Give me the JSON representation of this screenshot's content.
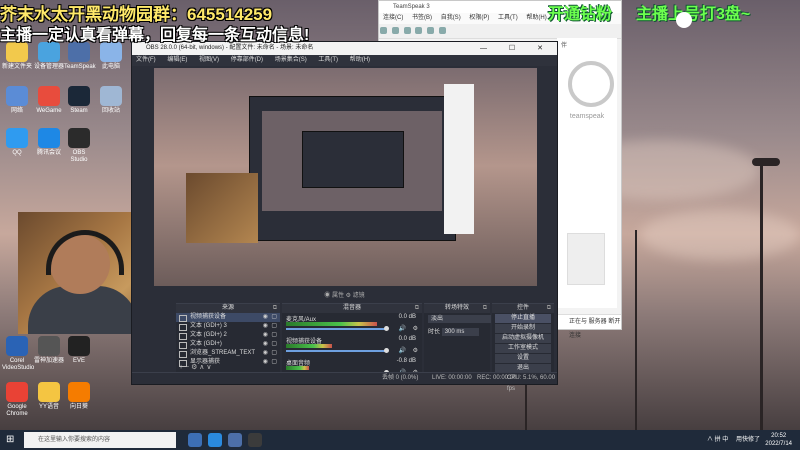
{
  "overlay": {
    "line1": "芥末水太开黑动物园群：645514259",
    "line2": "主播一定认真看弹幕，回复每一条互动信息!",
    "green1": "开通钻粉",
    "green2": "主播上号打3盘~"
  },
  "desktop_icons": [
    {
      "label": "新建文件夹",
      "color": "#f2c94c"
    },
    {
      "label": "设备管理器",
      "color": "#4aa3df"
    },
    {
      "label": "TeamSpeak",
      "color": "#4d6fa8"
    },
    {
      "label": "此电脑",
      "color": "#8ab4e8"
    },
    {
      "label": "网络",
      "color": "#5b8cd6"
    },
    {
      "label": "WeGame",
      "color": "#e84c3d"
    },
    {
      "label": "Steam",
      "color": "#1b2838"
    },
    {
      "label": "回收站",
      "color": "#9fb7d4"
    },
    {
      "label": "QQ",
      "color": "#2f9bf0"
    },
    {
      "label": "腾讯会议",
      "color": "#1e88e5"
    },
    {
      "label": "OBS Studio",
      "color": "#2b2b2b"
    },
    {
      "label": "Google Chrome",
      "color": "#e94235"
    },
    {
      "label": "YY语音",
      "color": "#f4c542"
    },
    {
      "label": "向日葵",
      "color": "#f57c00"
    },
    {
      "label": "Corel VideoStudio",
      "color": "#2a63b5"
    },
    {
      "label": "雷神加速器",
      "color": "#555"
    },
    {
      "label": "EVE",
      "color": "#222"
    }
  ],
  "obs": {
    "title": "OBS 28.0.0 (64-bit, windows) - 配置文件: 未命名 - 场景: 未命名",
    "window_buttons": "— ☐ ✕",
    "menu": [
      "文件(F)",
      "编辑(E)",
      "视图(V)",
      "停靠部件(D)",
      "场景集合(S)",
      "工具(T)",
      "帮助(H)"
    ],
    "preview_caption": "无标题",
    "preview_tools": "◉ 属性    ⚙ 滤镜",
    "dock_headers": {
      "scenes": "来源",
      "mixer": "混音器",
      "transitions": "转场特效",
      "controls": "控件"
    },
    "sources": [
      {
        "name": "视频捕获设备",
        "selected": true
      },
      {
        "name": "文本 (GDI+) 3",
        "selected": false
      },
      {
        "name": "文本 (GDI+) 2",
        "selected": false
      },
      {
        "name": "文本 (GDI+)",
        "selected": false
      },
      {
        "name": "浏览器_STREAM_TEXT",
        "selected": false
      },
      {
        "name": "显示器捕获",
        "selected": false
      }
    ],
    "mixer": [
      {
        "name": "麦克风/Aux",
        "db": "0.0 dB",
        "level": 0.8
      },
      {
        "name": "视频捕获设备",
        "db": "0.0 dB",
        "level": 0.4
      },
      {
        "name": "桌面音频",
        "db": "-0.8 dB",
        "level": 0.2
      }
    ],
    "transition": {
      "type": "淡出",
      "duration_label": "时长",
      "duration": "300 ms"
    },
    "controls": [
      {
        "label": "停止直播",
        "active": true
      },
      {
        "label": "开始录制",
        "active": false
      },
      {
        "label": "启动虚拟摄像机",
        "active": false
      },
      {
        "label": "工作室模式",
        "active": false
      },
      {
        "label": "设置",
        "active": false
      },
      {
        "label": "退出",
        "active": false
      }
    ],
    "status": {
      "dropped": "丢帧 0 (0.0%)",
      "live": "LIVE: 00:00:00",
      "rec": "REC: 00:00:00",
      "cpu": "CPU: 5.1%, 60.00 fps",
      "kbps": "0 kb/s"
    },
    "dock_footer": "+ − ⚙ ∧ ∨"
  },
  "teamspeak": {
    "title": "TeamSpeak 3",
    "menu": [
      "连接(C)",
      "书签(B)",
      "自我(S)",
      "权限(P)",
      "工具(T)",
      "帮助(H)"
    ],
    "pane_label": "伴",
    "logo_text": "teamspeak",
    "footer": "正在与 服务器 断开连接"
  },
  "taskbar": {
    "search_placeholder": "在这里输入你要搜索的内容",
    "tray_text": "∧ 拼 中",
    "network_status": "用快修了",
    "time": "20:52",
    "date": "2022/7/14"
  }
}
